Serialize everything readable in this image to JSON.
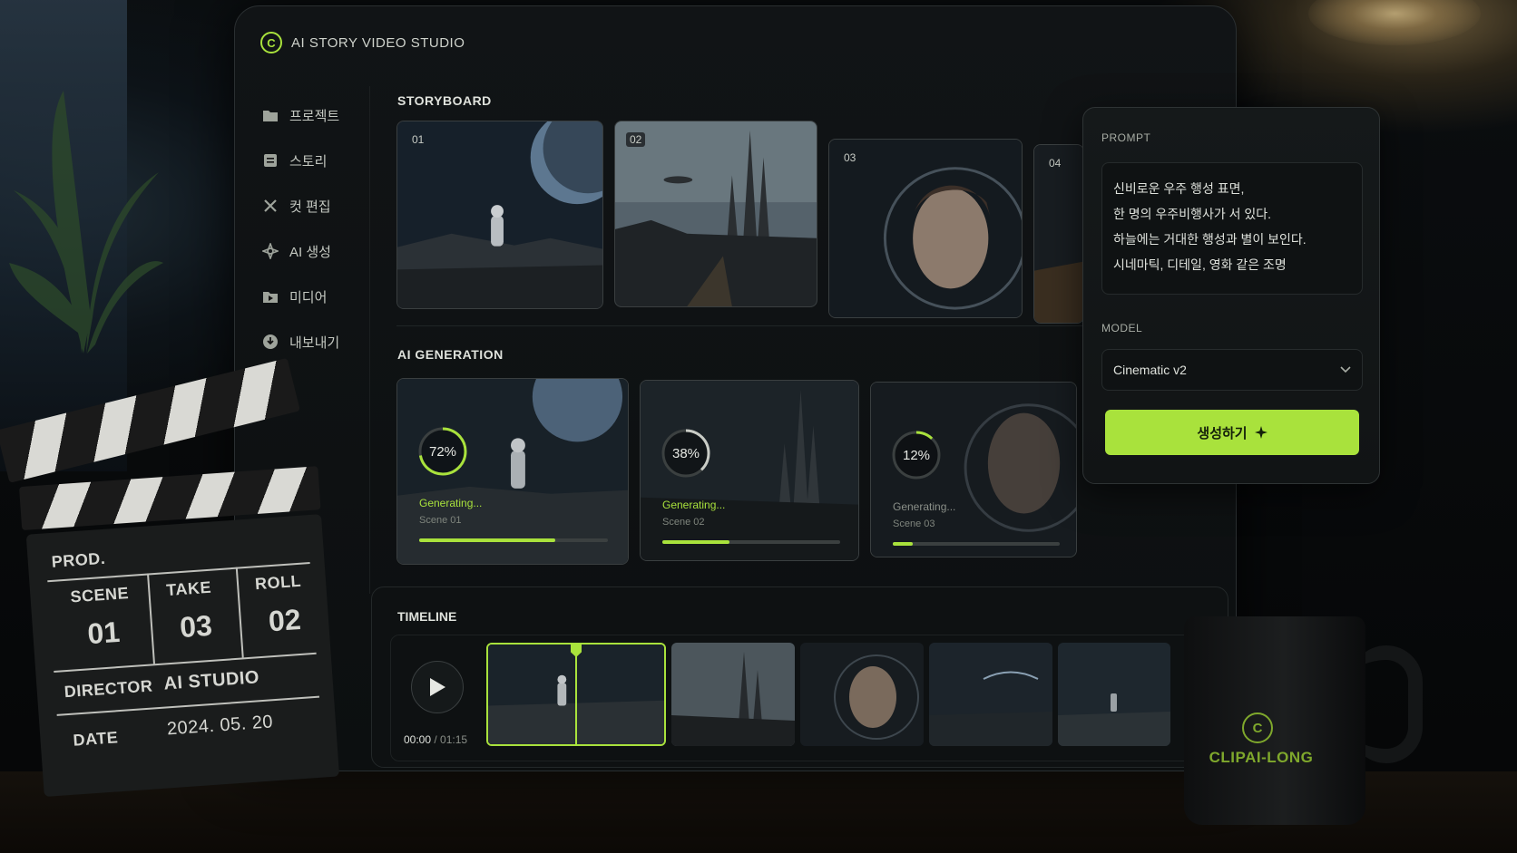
{
  "app": {
    "logo_letter": "C",
    "title": "AI STORY VIDEO STUDIO",
    "accent": "#a9e23c"
  },
  "sidebar": {
    "items": [
      {
        "label": "프로젝트",
        "icon": "folder-icon"
      },
      {
        "label": "스토리",
        "icon": "story-icon"
      },
      {
        "label": "컷 편집",
        "icon": "scissors-icon"
      },
      {
        "label": "AI 생성",
        "icon": "ai-sparkle-icon"
      },
      {
        "label": "미디어",
        "icon": "media-icon"
      },
      {
        "label": "내보내기",
        "icon": "export-icon"
      }
    ]
  },
  "storyboard": {
    "title": "STORYBOARD",
    "shots": [
      {
        "number": "01"
      },
      {
        "number": "02"
      },
      {
        "number": "03"
      },
      {
        "number": "04"
      }
    ]
  },
  "generation": {
    "title": "AI GENERATION",
    "jobs": [
      {
        "percent_label": "72%",
        "progress": 0.72,
        "status": "Generating...",
        "scene": "Scene 01"
      },
      {
        "percent_label": "38%",
        "progress": 0.38,
        "status": "Generating...",
        "scene": "Scene 02"
      },
      {
        "percent_label": "12%",
        "progress": 0.12,
        "status": "Generating...",
        "scene": "Scene 03"
      }
    ]
  },
  "timeline": {
    "title": "TIMELINE",
    "current_time": "00:00",
    "separator": " / ",
    "total_time": "01:15"
  },
  "prompt_panel": {
    "prompt_label": "PROMPT",
    "prompt_lines": [
      "신비로운 우주 행성 표면,",
      "한 명의 우주비행사가 서 있다.",
      "하늘에는 거대한 행성과 별이 보인다.",
      "시네마틱, 디테일, 영화 같은 조명"
    ],
    "model_label": "MODEL",
    "model_value": "Cinematic v2",
    "generate_label": "생성하기"
  },
  "clapperboard": {
    "prod_label": "PROD.",
    "scene_label": "SCENE",
    "scene_value": "01",
    "take_label": "TAKE",
    "take_value": "03",
    "roll_label": "ROLL",
    "roll_value": "02",
    "director_label": "DIRECTOR",
    "director_value": "AI STUDIO",
    "date_label": "DATE",
    "date_value": "2024. 05. 20"
  },
  "mug": {
    "logo_letter": "C",
    "brand": "CLIPAI-LONG"
  }
}
